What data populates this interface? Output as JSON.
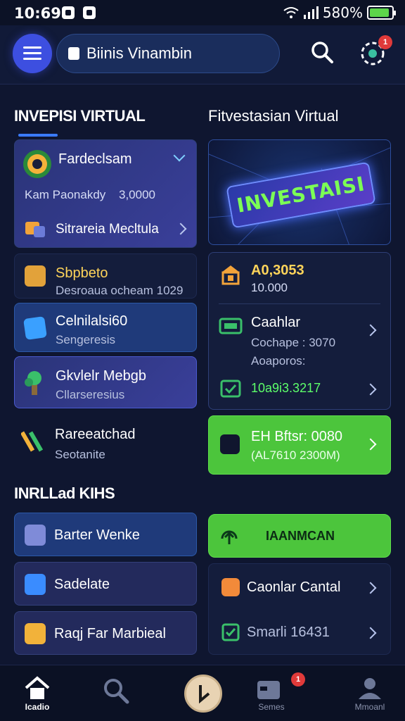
{
  "status": {
    "time": "10:69",
    "battery": "580%"
  },
  "header": {
    "title": "Biinis Vinambin",
    "notif_count": "1"
  },
  "left": {
    "section_title": "INVEPISI VIRTUAL",
    "profile_card": {
      "name": "Fardeclsam",
      "balance_text": "Kam Paonakdy",
      "balance_value": "3,0000",
      "link": "Sitrareia Mecltula"
    },
    "items": [
      {
        "title": "Sbpbeto",
        "subtitle": "Desroaua ocheam 1029"
      },
      {
        "title": "Celnilalsi60",
        "subtitle": "Sengeresis"
      },
      {
        "title": "Gkvlelr Mebgb",
        "subtitle": "Cllarseresius"
      },
      {
        "title": "Rareeatchad",
        "subtitle": "Seotanite"
      }
    ],
    "section2_title": "INRLLad KIHS",
    "actions": [
      "Barter Wenke",
      "Sadelate",
      "Raqj Far Marbieal"
    ]
  },
  "right": {
    "section_title": "Fitvestasian Virtual",
    "banner_text": "INVESTAISI",
    "stats": {
      "value1": "A0,3053",
      "value2": "10.000",
      "label": "Caahlar",
      "line1": "Cochape : 3070",
      "line2": "Aoaporos:",
      "green_value": "10a9i3.3217"
    },
    "green_card": {
      "title": "EH Bftsr: 0080",
      "subtitle": "(AL7610 2300M)"
    },
    "green_button": "IAANMCAN",
    "list": [
      {
        "label": "Caonlar Cantal"
      },
      {
        "label": "Smarli 16431"
      }
    ]
  },
  "nav": {
    "home": "Icadio",
    "search": "",
    "center": "",
    "games": "Semes",
    "account": "Mmoanl",
    "games_badge": "1"
  },
  "colors": {
    "accent": "#3d4fe0",
    "green": "#4cc53c",
    "background": "#0f1630"
  }
}
